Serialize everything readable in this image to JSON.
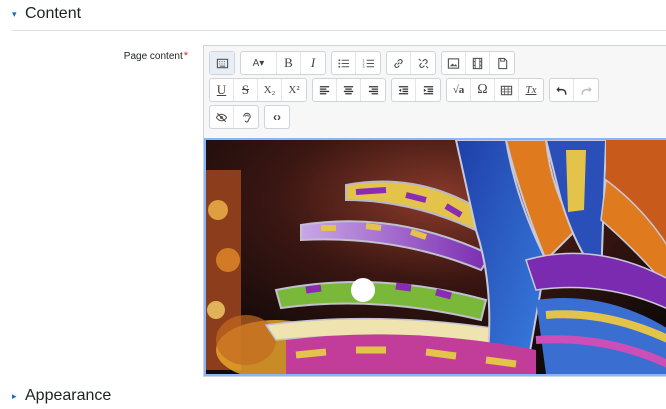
{
  "sections": {
    "content": {
      "title": "Content",
      "caret": "▾"
    },
    "appearance": {
      "title": "Appearance",
      "caret": "▸"
    }
  },
  "field": {
    "label": "Page content",
    "required_mark": "*"
  },
  "toolbar": {
    "row1": [
      [
        "toggle-toolbar"
      ],
      [
        "font-size",
        "bold",
        "italic"
      ],
      [
        "unordered-list",
        "ordered-list"
      ],
      [
        "link",
        "unlink"
      ],
      [
        "image",
        "media",
        "manage-files"
      ]
    ],
    "row2": [
      [
        "underline",
        "strikethrough",
        "subscript",
        "superscript"
      ],
      [
        "align-left",
        "align-center",
        "align-right"
      ],
      [
        "outdent",
        "indent"
      ],
      [
        "equation",
        "special-chars",
        "table",
        "clear-formatting"
      ],
      [
        "undo",
        "redo"
      ]
    ],
    "row3": [
      [
        "accessibility-checker",
        "screenreader-helper"
      ],
      [
        "html-source"
      ]
    ],
    "glyphs": {
      "bold": "B",
      "italic": "I",
      "underline": "U",
      "strikethrough": "S",
      "subscript": "X₂",
      "superscript": "X²",
      "special-chars": "Ω",
      "clear-formatting": "Tx",
      "font-size": "A▾",
      "html-source": "‹›",
      "equation": "√a"
    }
  },
  "editor": {
    "content_image": "carnival costume photo",
    "accent_color": "#86b7fe"
  }
}
